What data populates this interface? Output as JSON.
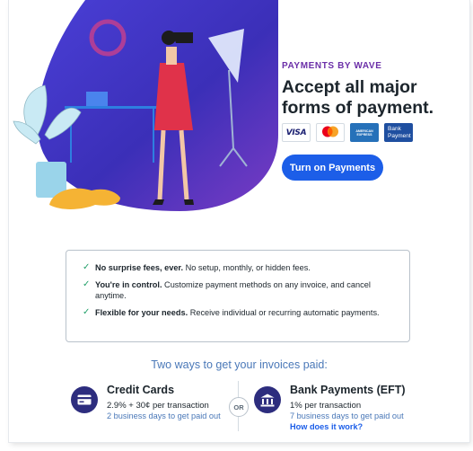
{
  "hero": {
    "eyebrow": "PAYMENTS BY WAVE",
    "headline": "Accept all major forms of payment.",
    "cta_label": "Turn on Payments",
    "badges": {
      "visa": "VISA",
      "mastercard_caption": "mastercard",
      "amex_line1": "AMERICAN",
      "amex_line2": "EXPRESS",
      "bank_line1": "Bank",
      "bank_line2": "Payment"
    }
  },
  "benefits": [
    {
      "title": "No surprise fees, ever.",
      "text": " No setup, monthly, or hidden fees."
    },
    {
      "title": "You're in control.",
      "text": " Customize payment methods on any invoice, and cancel anytime."
    },
    {
      "title": "Flexible for your needs.",
      "text": " Receive individual or recurring automatic payments."
    }
  ],
  "two_ways": {
    "heading": "Two ways to get your invoices paid:",
    "or_label": "OR",
    "credit": {
      "title": "Credit Cards",
      "fee": "2.9% + 30¢ per transaction",
      "payout": "2 business days to get paid out"
    },
    "bank": {
      "title": "Bank Payments (EFT)",
      "fee": "1% per transaction",
      "payout": "7 business days to get paid out",
      "link": "How does it work?"
    }
  },
  "colors": {
    "accent_blue": "#1c5ee8",
    "eyebrow_purple": "#6b2fa8",
    "icon_navy": "#2d2d7e",
    "check_green": "#23a06a"
  }
}
